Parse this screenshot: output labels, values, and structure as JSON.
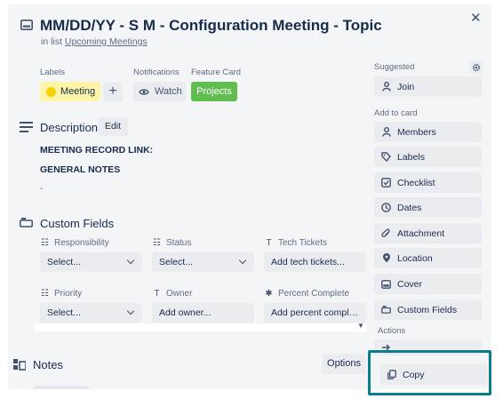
{
  "card": {
    "title": "MM/DD/YY - S M - Configuration Meeting - Topic",
    "in_list_prefix": "in list",
    "list_name": "Upcoming Meetings"
  },
  "labels": {
    "heading": "Labels",
    "chip_text": "Meeting",
    "chip_color": "#f5d300",
    "add_symbol": "+"
  },
  "notifications": {
    "heading": "Notifications",
    "watch_label": "Watch"
  },
  "feature_card": {
    "heading": "Feature Card",
    "button_label": "Projects",
    "color": "#61bd4f"
  },
  "description": {
    "title": "Description",
    "edit_label": "Edit",
    "lines": [
      "MEETING RECORD LINK:",
      "GENERAL NOTES",
      "-"
    ]
  },
  "custom_fields": {
    "title": "Custom Fields",
    "fields": [
      {
        "label": "Responsibility",
        "icon": "list-icon",
        "value": "Select..."
      },
      {
        "label": "Status",
        "icon": "list-icon",
        "value": "Select..."
      },
      {
        "label": "Tech Tickets",
        "icon": "text-icon",
        "value": "Add tech tickets..."
      },
      {
        "label": "Priority",
        "icon": "list-icon",
        "value": "Select..."
      },
      {
        "label": "Owner",
        "icon": "text-icon",
        "value": "Add owner..."
      },
      {
        "label": "Percent Complete",
        "icon": "number-icon",
        "value": "Add percent complete..."
      }
    ]
  },
  "notes": {
    "title": "Notes",
    "options_label": "Options"
  },
  "sidebar": {
    "suggested_heading": "Suggested",
    "join_label": "Join",
    "add_to_card_heading": "Add to card",
    "items": [
      {
        "label": "Members",
        "icon": "person-icon"
      },
      {
        "label": "Labels",
        "icon": "tag-icon"
      },
      {
        "label": "Checklist",
        "icon": "checkbox-icon"
      },
      {
        "label": "Dates",
        "icon": "clock-icon"
      },
      {
        "label": "Attachment",
        "icon": "paperclip-icon"
      },
      {
        "label": "Location",
        "icon": "pin-icon"
      },
      {
        "label": "Cover",
        "icon": "cover-icon"
      },
      {
        "label": "Custom Fields",
        "icon": "custom-fields-icon"
      }
    ],
    "actions_heading": "Actions",
    "copy_label": "Copy",
    "highlight_color": "#0b7d8c"
  }
}
